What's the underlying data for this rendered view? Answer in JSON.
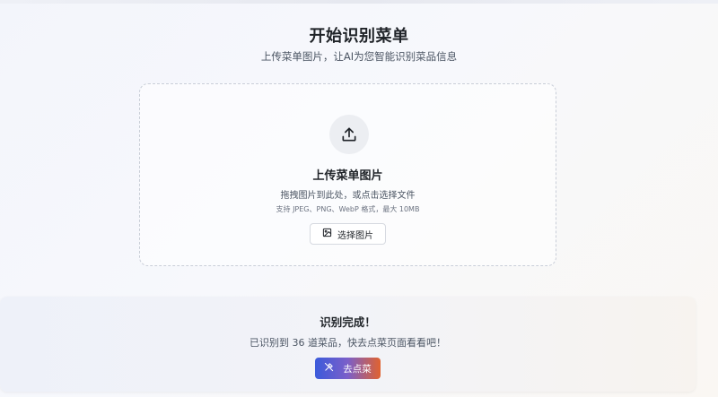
{
  "header": {
    "title": "开始识别菜单",
    "subtitle": "上传菜单图片，让AI为您智能识别菜品信息"
  },
  "upload": {
    "icon": "upload-icon",
    "heading": "上传菜单图片",
    "description": "拖拽图片到此处，或点击选择文件",
    "hint": "支持 JPEG、PNG、WebP 格式，最大 10MB",
    "button_icon": "image-icon",
    "button_label": "选择图片"
  },
  "result": {
    "title": "识别完成！",
    "description": "已识别到 36 道菜品，快去点菜页面看看吧！",
    "button_icon": "utensils-icon",
    "button_label": "去点菜"
  },
  "colors": {
    "accent_start": "#3b5bdb",
    "accent_end": "#e0622f",
    "text_primary": "#1f2328",
    "text_secondary": "#4b5563"
  }
}
